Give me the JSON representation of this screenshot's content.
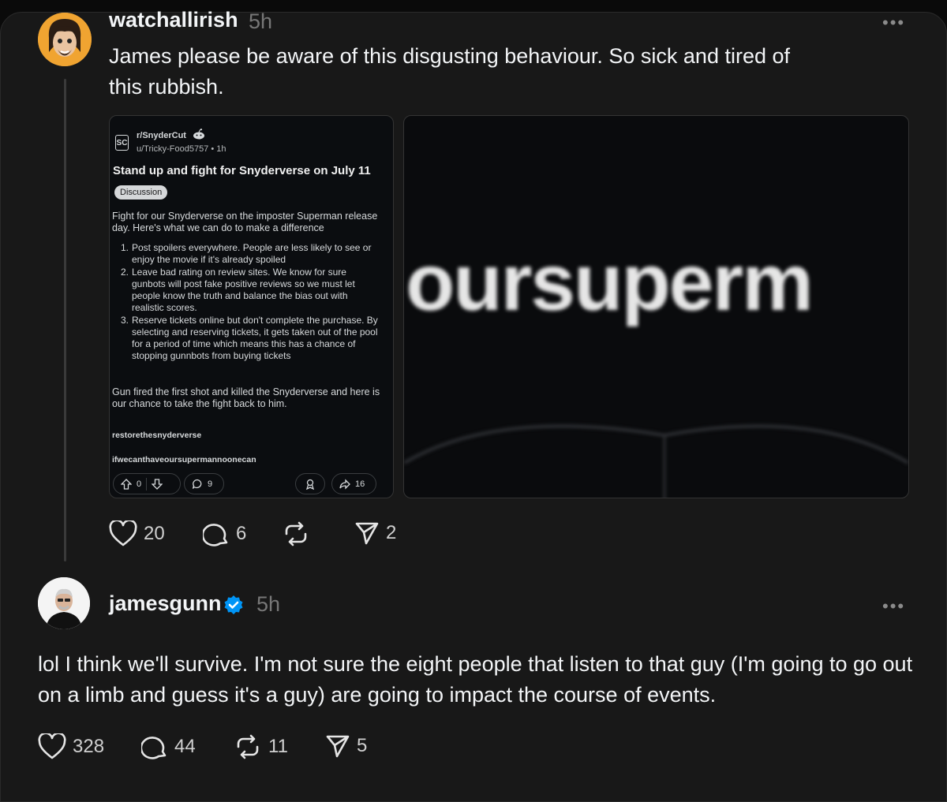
{
  "post": {
    "username": "watchallirish",
    "time": "5h",
    "more": "•••",
    "text": "James please be aware of this disgusting behaviour. So sick and tired of this rubbish.",
    "actions": {
      "likes": "20",
      "replies": "6",
      "reposts": "",
      "shares": "2"
    }
  },
  "reddit": {
    "badge": "SC",
    "subreddit": "r/SnyderCut",
    "user_line": "u/Tricky-Food5757 • 1h",
    "title": "Stand up and fight for Snyderverse on July 11",
    "flair": "Discussion",
    "intro": "Fight for our Snyderverse on the imposter Superman release day. Here's what we can do to make a difference",
    "items": [
      {
        "num": "1.",
        "text": "Post spoilers everywhere. People are less likely to see or enjoy the movie if it's already spoiled"
      },
      {
        "num": "2.",
        "text": "Leave bad rating on review sites. We know for sure gunbots will post fake positive reviews so we must let people know the truth and balance the bias out with realistic scores."
      },
      {
        "num": "3.",
        "text": "Reserve tickets online but don't complete the purchase. By selecting and reserving tickets, it gets taken out of the pool for a period of time which means this has a chance of stopping gunnbots from buying tickets"
      }
    ],
    "closing": "Gun fired the first shot and killed the Snyderverse and here is our chance to take the fight back to him.",
    "tag1": "restorethesnyderverse",
    "tag2": "ifwecanthaveoursupermannoonecan",
    "votes": "0",
    "comments": "9",
    "shares": "16"
  },
  "image": {
    "text": "oursuperm"
  },
  "reply": {
    "username": "jamesgunn",
    "time": "5h",
    "more": "•••",
    "text": "lol I think we'll survive. I'm not sure the eight people that listen to that guy (I'm going to go out on a limb and guess it's a guy) are going to impact the course of events.",
    "actions": {
      "likes": "328",
      "replies": "44",
      "reposts": "11",
      "shares": "5"
    }
  },
  "colors": {
    "background": "#181818",
    "verified": "#0095f6",
    "text": "#f3f5f7",
    "muted": "#777777"
  }
}
